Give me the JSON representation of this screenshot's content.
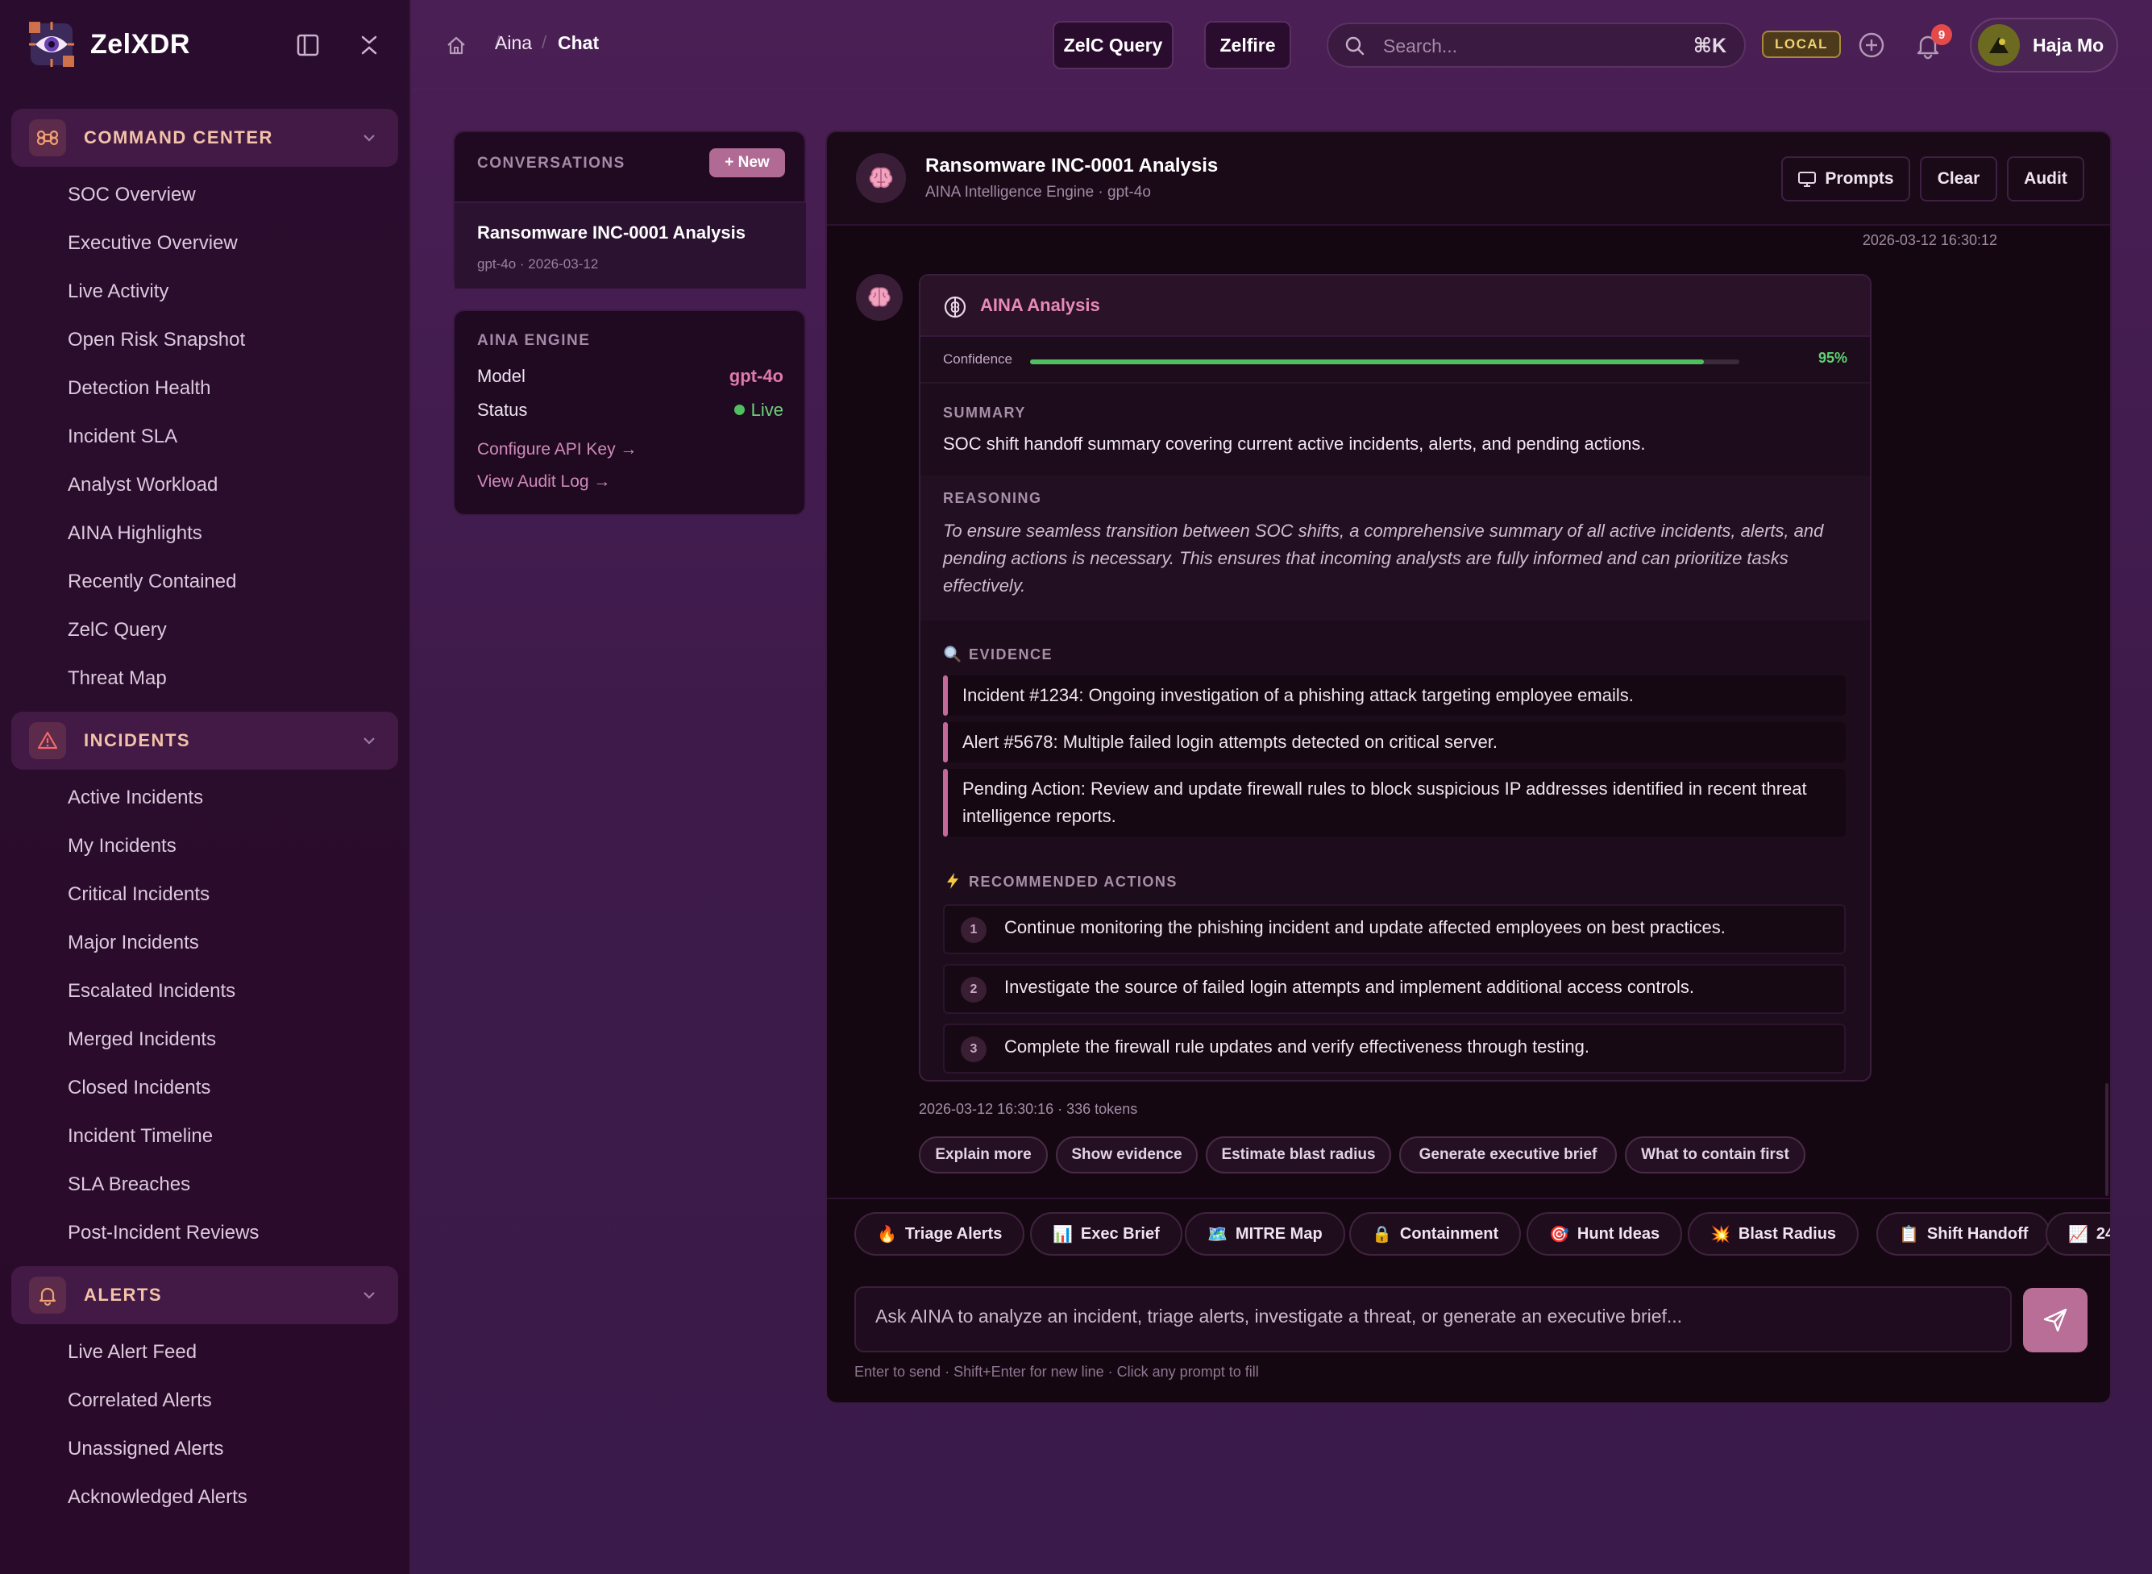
{
  "brand": {
    "name": "ZelXDR"
  },
  "sidebar": {
    "groups": [
      {
        "label": "COMMAND CENTER",
        "items": [
          "SOC Overview",
          "Executive Overview",
          "Live Activity",
          "Open Risk Snapshot",
          "Detection Health",
          "Incident SLA",
          "Analyst Workload",
          "AINA Highlights",
          "Recently Contained",
          "ZelC Query",
          "Threat Map"
        ]
      },
      {
        "label": "INCIDENTS",
        "items": [
          "Active Incidents",
          "My Incidents",
          "Critical Incidents",
          "Major Incidents",
          "Escalated Incidents",
          "Merged Incidents",
          "Closed Incidents",
          "Incident Timeline",
          "SLA Breaches",
          "Post-Incident Reviews"
        ]
      },
      {
        "label": "ALERTS",
        "items": [
          "Live Alert Feed",
          "Correlated Alerts",
          "Unassigned Alerts",
          "Acknowledged Alerts"
        ]
      }
    ]
  },
  "topbar": {
    "breadcrumb": [
      "Aina",
      "Chat"
    ],
    "btn_query": "ZelC Query",
    "btn_zelfire": "Zelfire",
    "search_placeholder": "Search...",
    "search_shortcut": "⌘K",
    "env_badge": "LOCAL",
    "notif_count": "9",
    "user_name": "Haja Mo"
  },
  "conversations": {
    "title": "CONVERSATIONS",
    "new_label": "+ New",
    "items": [
      {
        "title": "Ransomware INC-0001 Analysis",
        "meta": "gpt-4o · 2026-03-12"
      }
    ]
  },
  "engine": {
    "title": "AINA ENGINE",
    "model_label": "Model",
    "model_value": "gpt-4o",
    "status_label": "Status",
    "status_value": "Live",
    "link_api": "Configure API Key →",
    "link_audit": "View Audit Log →"
  },
  "chat": {
    "title": "Ransomware INC-0001 Analysis",
    "subtitle": "AINA Intelligence Engine · gpt-4o",
    "btn_prompts": "Prompts",
    "btn_clear": "Clear",
    "btn_audit": "Audit",
    "timestamp_top": "2026-03-12 16:30:12",
    "card": {
      "title": "AINA Analysis",
      "confidence_label": "Confidence",
      "confidence_value": "95%",
      "confidence_fraction": 0.95,
      "summary_label": "SUMMARY",
      "summary": "SOC shift handoff summary covering current active incidents, alerts, and pending actions.",
      "reasoning_label": "REASONING",
      "reasoning": "To ensure seamless transition between SOC shifts, a comprehensive summary of all active incidents, alerts, and pending actions is necessary. This ensures that incoming analysts are fully informed and can prioritize tasks effectively.",
      "evidence_label": "EVIDENCE",
      "evidence": [
        "Incident #1234: Ongoing investigation of a phishing attack targeting employee emails.",
        "Alert #5678: Multiple failed login attempts detected on critical server.",
        "Pending Action: Review and update firewall rules to block suspicious IP addresses identified in recent threat intelligence reports."
      ],
      "actions_label": "RECOMMENDED ACTIONS",
      "actions": [
        "Continue monitoring the phishing incident and update affected employees on best practices.",
        "Investigate the source of failed login attempts and implement additional access controls.",
        "Complete the firewall rule updates and verify effectiveness through testing."
      ]
    },
    "message_meta": "2026-03-12 16:30:16 · 336 tokens",
    "followups": [
      "Explain more",
      "Show evidence",
      "Estimate blast radius",
      "Generate executive brief",
      "What to contain first"
    ],
    "prompts": [
      {
        "emoji": "🔥",
        "label": "Triage Alerts"
      },
      {
        "emoji": "📊",
        "label": "Exec Brief"
      },
      {
        "emoji": "🗺️",
        "label": "MITRE Map"
      },
      {
        "emoji": "🔒",
        "label": "Containment"
      },
      {
        "emoji": "🎯",
        "label": "Hunt Ideas"
      },
      {
        "emoji": "💥",
        "label": "Blast Radius"
      },
      {
        "emoji": "📋",
        "label": "Shift Handoff"
      },
      {
        "emoji": "📈",
        "label": "24"
      }
    ],
    "composer_placeholder": "Ask AINA to analyze an incident, triage alerts, investigate a threat, or generate an executive brief...",
    "hint": "Enter to send · Shift+Enter for new line · Click any prompt to fill"
  }
}
